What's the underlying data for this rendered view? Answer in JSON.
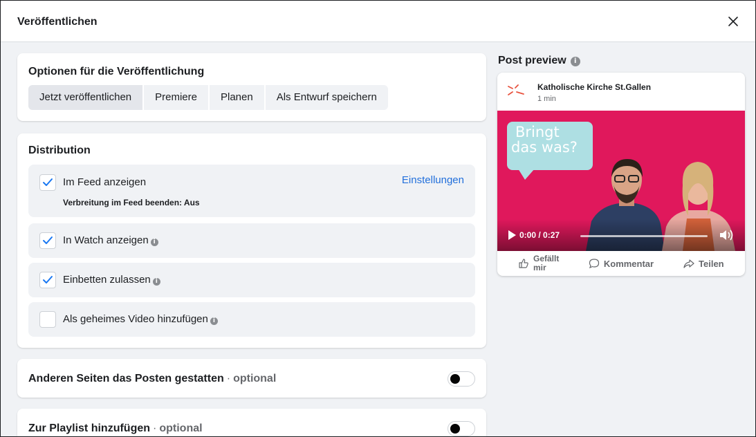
{
  "dialog": {
    "title": "Veröffentlichen"
  },
  "options": {
    "title": "Optionen für die Veröffentlichung",
    "tabs": [
      {
        "label": "Jetzt veröffentlichen",
        "active": true
      },
      {
        "label": "Premiere",
        "active": false
      },
      {
        "label": "Planen",
        "active": false
      },
      {
        "label": "Als Entwurf speichern",
        "active": false
      }
    ]
  },
  "distribution": {
    "title": "Distribution",
    "feed": {
      "label": "Im Feed anzeigen",
      "checked": true,
      "settings_link": "Einstellungen",
      "sub": "Verbreitung im Feed beenden: Aus"
    },
    "watch": {
      "label": "In Watch anzeigen",
      "checked": true
    },
    "embed": {
      "label": "Einbetten zulassen",
      "checked": true
    },
    "secret": {
      "label": "Als geheimes Video hinzufügen",
      "checked": false
    }
  },
  "other_pages": {
    "title": "Anderen Seiten das Posten gestatten",
    "dot": "·",
    "optional": "optional",
    "enabled": false
  },
  "playlist": {
    "title": "Zur Playlist hinzufügen",
    "dot": "·",
    "optional": "optional",
    "enabled": false
  },
  "preview": {
    "title": "Post preview",
    "page_name": "Katholische Kirche St.Gallen",
    "time": "1 min",
    "video": {
      "bubble_line1": "Bringt",
      "bubble_line2": "das was?",
      "time": "0:00 / 0:27",
      "progress": 0
    },
    "actions": {
      "like_line1": "Gefällt",
      "like_line2": "mir",
      "comment": "Kommentar",
      "share": "Teilen"
    }
  },
  "colors": {
    "accent": "#216fdb",
    "check": "#1877f2",
    "video_bg": "#e0185c",
    "bubble": "#aedfe3",
    "logo": "#e8533f"
  },
  "icons": [
    "close-icon",
    "check-icon",
    "info-icon",
    "like-icon",
    "comment-icon",
    "share-icon",
    "play-icon",
    "volume-icon"
  ]
}
